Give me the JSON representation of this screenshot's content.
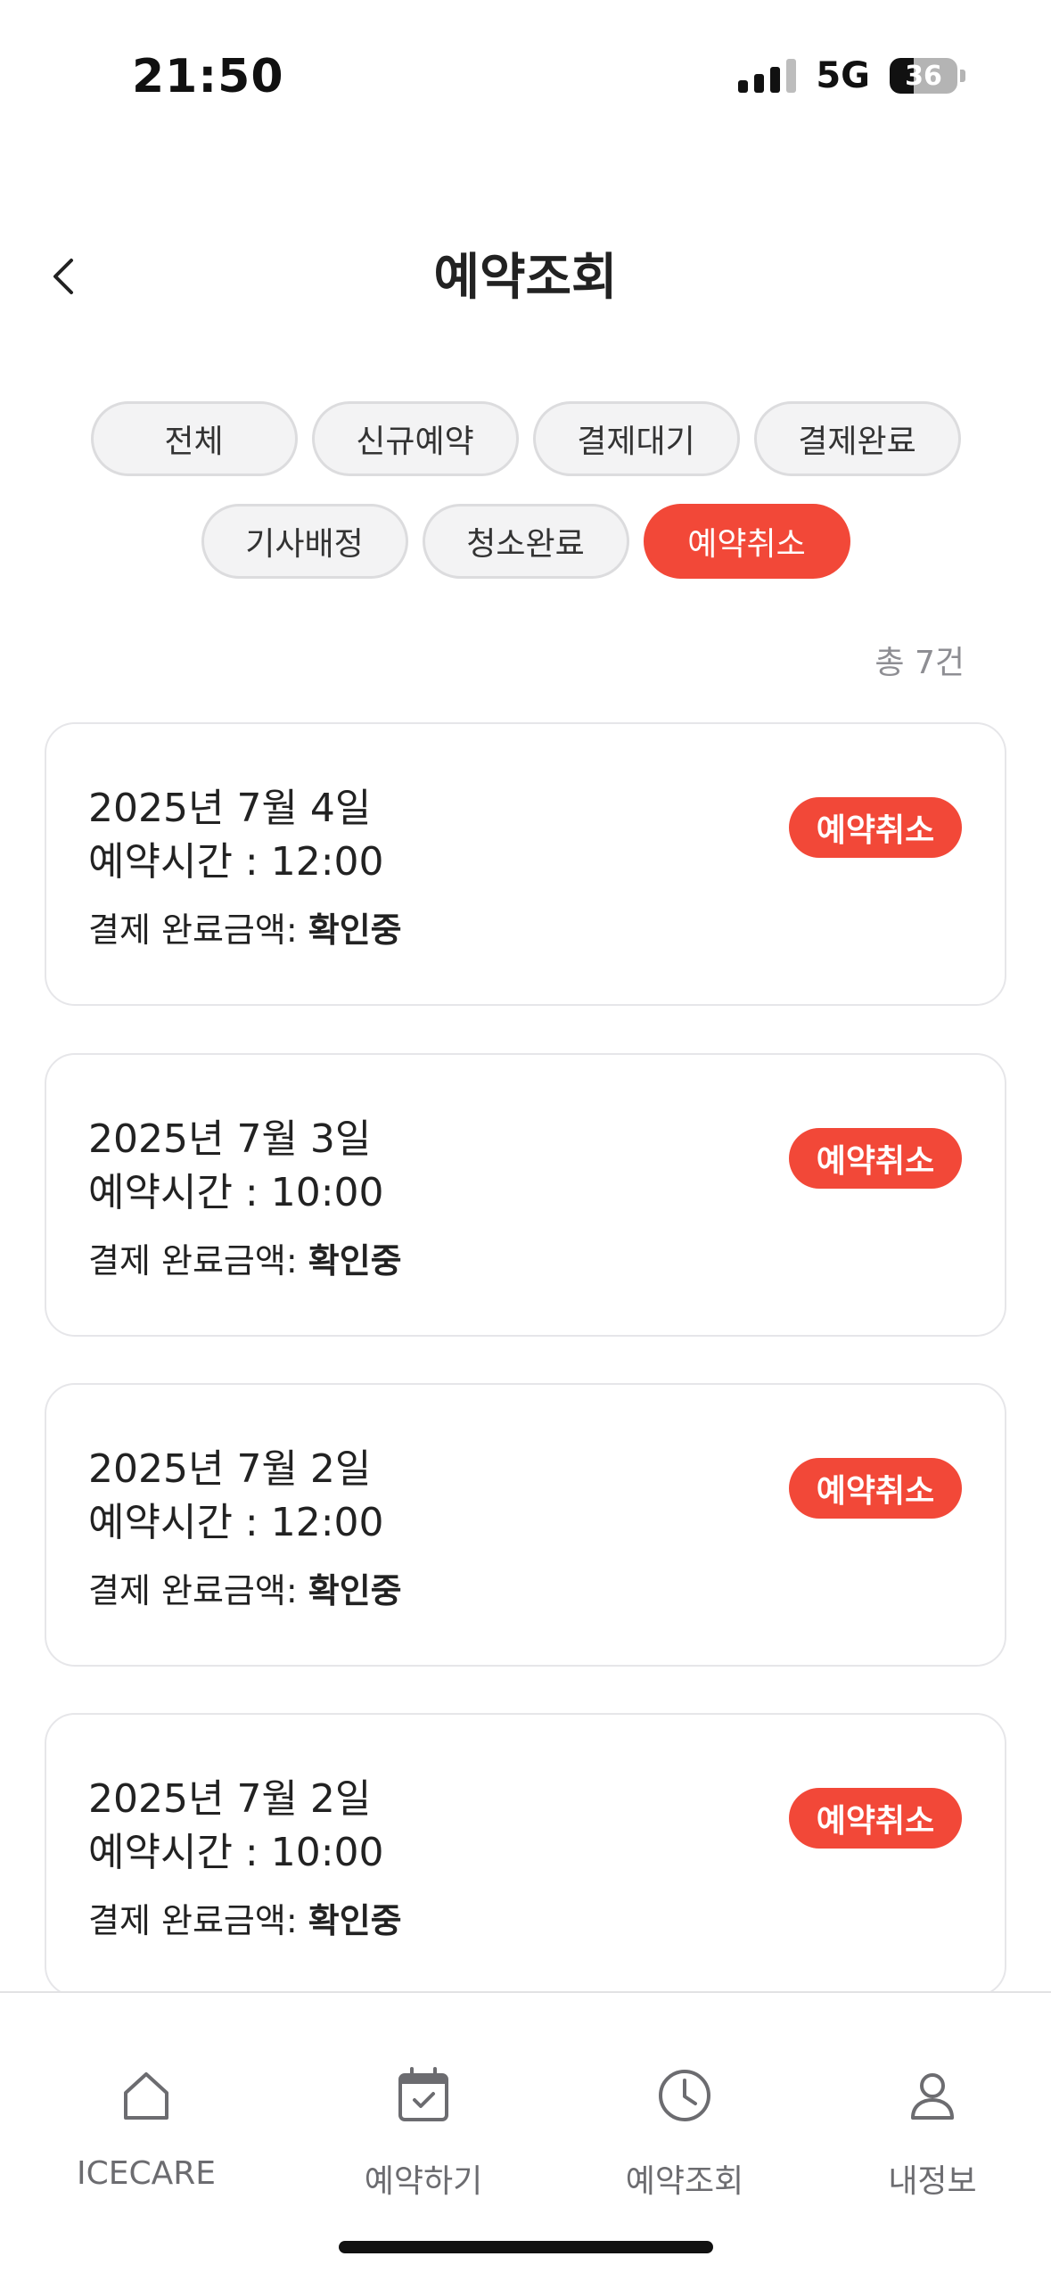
{
  "status_bar": {
    "time": "21:50",
    "network": "5G",
    "battery_percent": "36",
    "battery_level": 0.36
  },
  "header": {
    "title": "예약조회",
    "back_icon": "chevron-left-icon"
  },
  "filters": {
    "row1": [
      "전체",
      "신규예약",
      "결제대기",
      "결제완료"
    ],
    "row2": [
      "기사배정",
      "청소완료",
      "예약취소"
    ],
    "active": "예약취소"
  },
  "total_count": "총 7건",
  "reservations": [
    {
      "date": "2025년 7월 4일",
      "time": "예약시간 : 12:00",
      "pay_label": "결제 완료금액: ",
      "pay_value": "확인중",
      "status": "예약취소"
    },
    {
      "date": "2025년 7월 3일",
      "time": "예약시간 : 10:00",
      "pay_label": "결제 완료금액: ",
      "pay_value": "확인중",
      "status": "예약취소"
    },
    {
      "date": "2025년 7월 2일",
      "time": "예약시간 : 12:00",
      "pay_label": "결제 완료금액: ",
      "pay_value": "확인중",
      "status": "예약취소"
    },
    {
      "date": "2025년 7월 2일",
      "time": "예약시간 : 10:00",
      "pay_label": "결제 완료금액: ",
      "pay_value": "확인중",
      "status": "예약취소"
    }
  ],
  "bottom_nav": [
    {
      "label": "ICECARE",
      "icon": "home-icon"
    },
    {
      "label": "예약하기",
      "icon": "calendar-check-icon"
    },
    {
      "label": "예약조회",
      "icon": "clock-icon"
    },
    {
      "label": "내정보",
      "icon": "user-icon"
    }
  ],
  "colors": {
    "accent": "#f24838",
    "chip_bg": "#f3f3f4",
    "muted_text": "#8e8e93"
  }
}
